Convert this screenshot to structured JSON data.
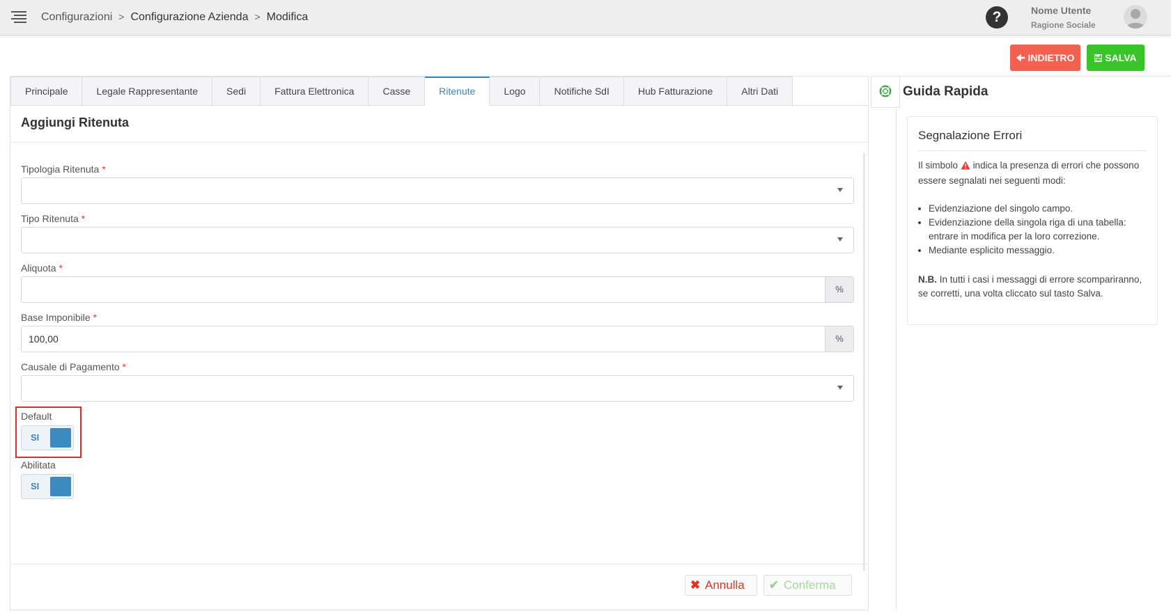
{
  "header": {
    "breadcrumb": [
      "Configurazioni",
      "Configurazione Azienda",
      "Modifica"
    ],
    "user_name": "Nome Utente",
    "user_company": "Ragione Sociale",
    "help_glyph": "?"
  },
  "actions": {
    "back_label": "INDIETRO",
    "save_label": "SALVA"
  },
  "tabs": [
    {
      "label": "Principale"
    },
    {
      "label": "Legale Rappresentante"
    },
    {
      "label": "Sedi"
    },
    {
      "label": "Fattura Elettronica"
    },
    {
      "label": "Casse"
    },
    {
      "label": "Ritenute",
      "active": true
    },
    {
      "label": "Logo"
    },
    {
      "label": "Notifiche SdI"
    },
    {
      "label": "Hub Fatturazione"
    },
    {
      "label": "Altri Dati"
    }
  ],
  "form": {
    "title": "Aggiungi Ritenuta",
    "required_mark": "*",
    "tipologia_label": "Tipologia Ritenuta",
    "tipologia_value": "",
    "tipo_label": "Tipo Ritenuta",
    "tipo_value": "",
    "aliquota_label": "Aliquota",
    "aliquota_value": "",
    "aliquota_addon": "%",
    "base_label": "Base Imponibile",
    "base_value": "100,00",
    "base_addon": "%",
    "causale_label": "Causale di Pagamento",
    "causale_value": "",
    "default_label": "Default",
    "default_toggle": "SI",
    "abilitata_label": "Abilitata",
    "abilitata_toggle": "SI",
    "annulla_label": "Annulla",
    "conferma_label": "Conferma"
  },
  "guide": {
    "title": "Guida Rapida",
    "card_title": "Segnalazione Errori",
    "intro_before": "Il simbolo",
    "intro_after": "indica la presenza di errori che possono essere segnalati nei seguenti modi:",
    "items": [
      "Evidenziazione del singolo campo.",
      "Evidenziazione della singola riga di una tabella: entrare in modifica per la loro correzione.",
      "Mediante esplicito messaggio."
    ],
    "nb_label": "N.B.",
    "nb_text": "In tutti i casi i messaggi di errore scompariranno, se corretti, una volta cliccato sul tasto Salva."
  },
  "colors": {
    "accent": "#3b84b9",
    "back_button": "#f26150",
    "save_button": "#39c42a",
    "error_red": "#e53935"
  }
}
